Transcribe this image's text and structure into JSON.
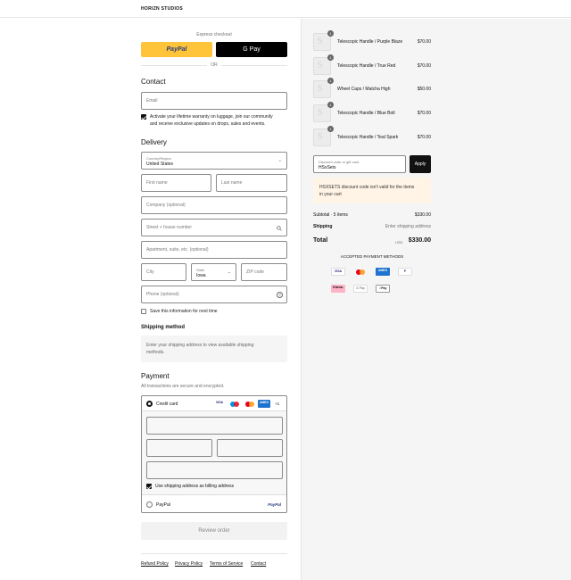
{
  "brand": "HORIZN STUDIOS",
  "express": {
    "title": "Express checkout",
    "paypal_label": "PayPal",
    "gpay_label": "G Pay",
    "or_label": "OR"
  },
  "contact": {
    "title": "Contact",
    "email_placeholder": "Email",
    "newsletter_text_line1": "Activate your lifetime warranty on luggage, join our community",
    "newsletter_text_line2": "and receive exclusive updates on drops, sales and events.",
    "newsletter_checked": true
  },
  "delivery": {
    "title": "Delivery",
    "country_label": "Country/Region",
    "country_value": "United States",
    "first_name_placeholder": "First name",
    "last_name_placeholder": "Last name",
    "company_placeholder": "Company (optional)",
    "street_placeholder": "Street + house number",
    "apartment_placeholder": "Apartment, suite, etc. (optional)",
    "city_placeholder": "City",
    "state_label": "State",
    "state_value": "Iowa",
    "zip_placeholder": "ZIP code",
    "phone_placeholder": "Phone (optional)",
    "save_info_label": "Save this information for next time",
    "save_info_checked": false
  },
  "shipping": {
    "title": "Shipping method",
    "notice_line1": "Enter your shipping address to view available shipping",
    "notice_line2": "methods."
  },
  "payment": {
    "title": "Payment",
    "subtitle": "All transactions are secure and encrypted.",
    "credit_card_label": "Credit card",
    "more_cards": "+1",
    "card_brands": [
      "VISA",
      "MC",
      "MC",
      "AMEX"
    ],
    "billing_label": "Use shipping address as billing address",
    "billing_checked": true,
    "paypal_label": "PayPal",
    "paypal_logo": "PayPal"
  },
  "review_button": "Review order",
  "footer_links": [
    "Refund Policy",
    "Privacy Policy",
    "Terms of Service",
    "Contact"
  ],
  "cart": {
    "items": [
      {
        "name": "Telescopic Handle / Purple Blaze",
        "price": "$70.00",
        "qty": "1"
      },
      {
        "name": "Telescopic Handle / True Red",
        "price": "$70.00",
        "qty": "1"
      },
      {
        "name": "Wheel Caps / Matcha High",
        "price": "$50.00",
        "qty": "1"
      },
      {
        "name": "Telescopic Handle / Blue Bolt",
        "price": "$70.00",
        "qty": "1"
      },
      {
        "name": "Telescopic Handle / Teal Spark",
        "price": "$70.00",
        "qty": "1"
      }
    ],
    "discount_label": "Discount code or gift card",
    "discount_value": "HSxSets",
    "apply_label": "Apply",
    "error_line1": "HSXSETS discount code isn't valid for the items",
    "error_line2": "in your cart",
    "subtotal_label": "Subtotal · 5 items",
    "subtotal_value": "$330.00",
    "shipping_label": "Shipping",
    "shipping_value": "Enter shipping address",
    "total_label": "Total",
    "total_currency": "USD",
    "total_value": "$330.00",
    "accepted_title": "ACCEPTED PAYMENT METHODS",
    "methods_row1": [
      "VISA",
      "MC",
      "AMEX",
      "P"
    ],
    "methods_row2": [
      "Klarna.",
      "G Pay",
      "Pay"
    ]
  },
  "colors": {
    "paypal_yellow": "#ffc439",
    "black": "#000000",
    "error_bg": "#fff4e5",
    "panel_bg": "#f5f5f5"
  }
}
